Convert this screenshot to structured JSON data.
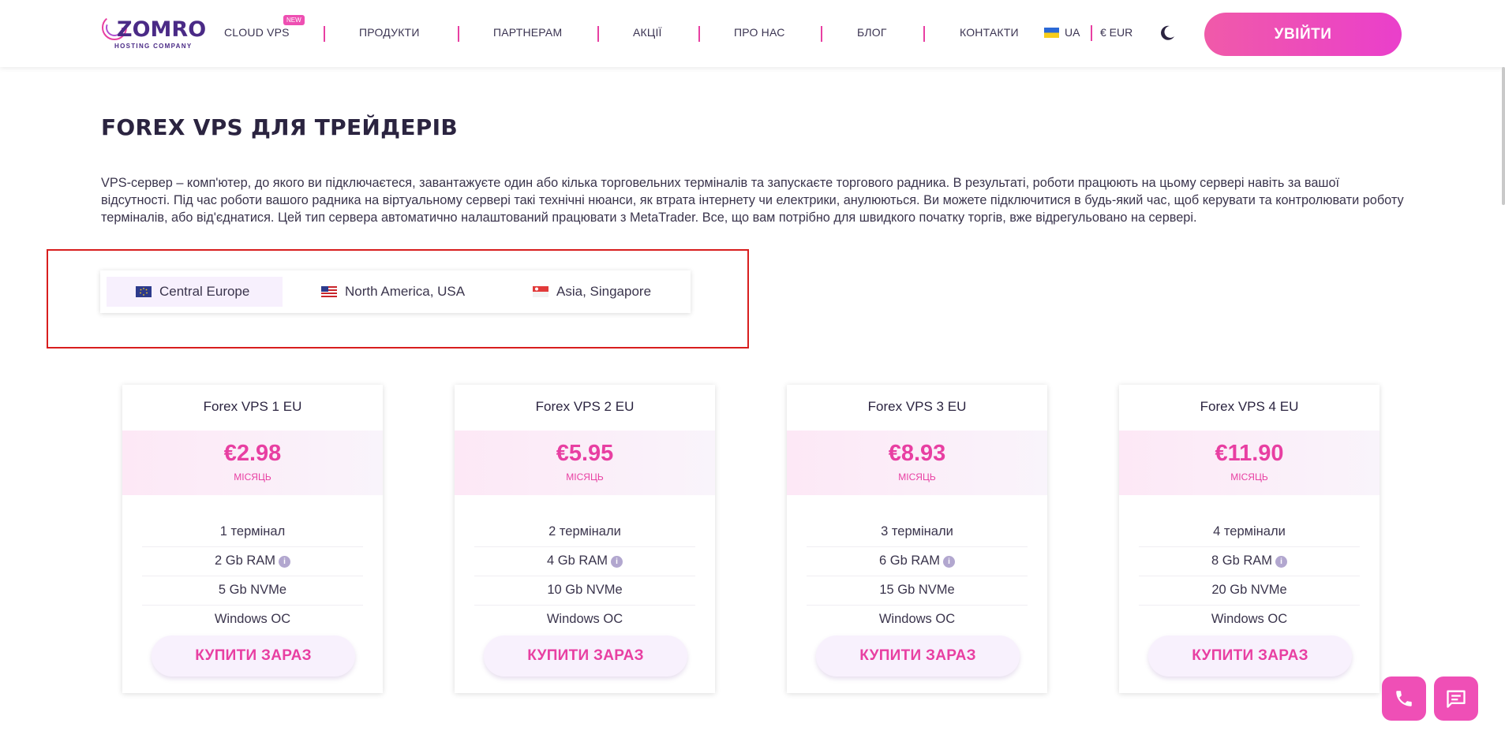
{
  "header": {
    "logo_word": "ZOMRO",
    "logo_sub": "HOSTING COMPANY",
    "nav": [
      "CLOUD VPS",
      "ПРОДУКТИ",
      "ПАРТНЕРАМ",
      "АКЦІЇ",
      "ПРО НАС",
      "БЛОГ",
      "КОНТАКТИ"
    ],
    "new_badge": "NEW",
    "language": "UA",
    "currency": "€ EUR",
    "login_label": "УВІЙТИ",
    "accent_color": "#e83fa2"
  },
  "main": {
    "title": "FOREX VPS ДЛЯ ТРЕЙДЕРІВ",
    "description": "VPS-сервер – комп'ютер, до якого ви підключаєтеся, завантажуєте один або кілька торговельних терміналів та запускаєте торгового радника. В результаті, роботи працюють на цьому сервері навіть за вашої відсутності. Під час роботи вашого радника на віртуальному сервері такі технічні нюанси, як втрата інтернету чи електрики, анулюються. Ви можете підключитися в будь-який час, щоб керувати та контролювати роботу терміналів, або від'єднатися. Цей тип сервера автоматично налаштований працювати з MetaTrader. Все, що вам потрібно для швидкого початку торгів, вже відрегульовано на сервері.",
    "regions": [
      {
        "label": "Central Europe",
        "icon": "eu-flag-icon",
        "active": true
      },
      {
        "label": "North America, USA",
        "icon": "us-flag-icon",
        "active": false
      },
      {
        "label": "Asia, Singapore",
        "icon": "sg-flag-icon",
        "active": false
      }
    ],
    "plans": [
      {
        "name": "Forex VPS 1 EU",
        "price": "€2.98",
        "period": "МІСЯЦЬ",
        "terminals": "1 термінал",
        "ram": "2 Gb RAM",
        "disk": "5 Gb NVMe",
        "os": "Windows ОС",
        "buy": "КУПИТИ ЗАРАЗ"
      },
      {
        "name": "Forex VPS 2 EU",
        "price": "€5.95",
        "period": "МІСЯЦЬ",
        "terminals": "2 термінали",
        "ram": "4 Gb RAM",
        "disk": "10 Gb NVMe",
        "os": "Windows ОС",
        "buy": "КУПИТИ ЗАРАЗ"
      },
      {
        "name": "Forex VPS 3 EU",
        "price": "€8.93",
        "period": "МІСЯЦЬ",
        "terminals": "3 термінали",
        "ram": "6 Gb RAM",
        "disk": "15 Gb NVMe",
        "os": "Windows ОС",
        "buy": "КУПИТИ ЗАРАЗ"
      },
      {
        "name": "Forex VPS 4 EU",
        "price": "€11.90",
        "period": "МІСЯЦЬ",
        "terminals": "4 термінали",
        "ram": "8 Gb RAM",
        "disk": "20 Gb NVMe",
        "os": "Windows ОС",
        "buy": "КУПИТИ ЗАРАЗ"
      }
    ]
  },
  "floating": {
    "call_icon": "phone-icon",
    "chat_icon": "chat-icon"
  }
}
